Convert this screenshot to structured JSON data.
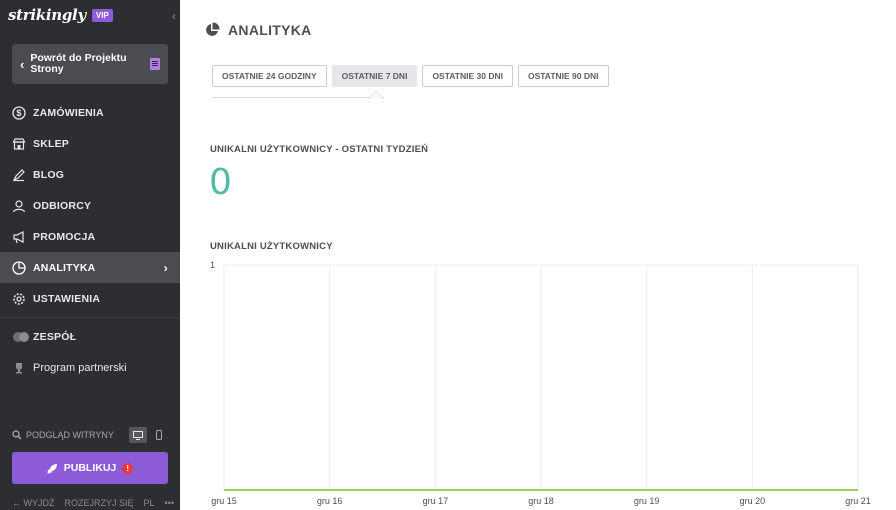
{
  "sidebar": {
    "brand": "strikingly",
    "badge": "VIP",
    "back_label": "Powrót do Projektu Strony",
    "items": [
      {
        "label": "ZAMÓWIENIA",
        "icon": "dollar-circle-icon"
      },
      {
        "label": "SKLEP",
        "icon": "store-icon"
      },
      {
        "label": "BLOG",
        "icon": "pen-icon"
      },
      {
        "label": "ODBIORCY",
        "icon": "audience-icon"
      },
      {
        "label": "PROMOCJA",
        "icon": "megaphone-icon"
      },
      {
        "label": "ANALITYKA",
        "icon": "pie-chart-icon",
        "active": true
      },
      {
        "label": "USTAWIENIA",
        "icon": "gear-icon"
      },
      {
        "label": "ZESPÓŁ",
        "icon": "team-icon"
      },
      {
        "label": "Program partnerski",
        "icon": "trophy-icon"
      }
    ],
    "preview_label": "PODGLĄD WITRYNY",
    "publish_label": "PUBLIKUJ",
    "footer": {
      "logout": "WYJDŹ",
      "browse": "ROZEJRZYJ SIĘ",
      "lang": "PL",
      "more": "•••"
    }
  },
  "main": {
    "title": "ANALITYKA",
    "tabs": [
      {
        "label": "OSTATNIE 24 GODZINY",
        "active": false
      },
      {
        "label": "OSTATNIE 7 DNI",
        "active": true
      },
      {
        "label": "OSTATNIE 30 DNI",
        "active": false
      },
      {
        "label": "OSTATNIE 90 DNI",
        "active": false
      }
    ],
    "stat_label": "UNIKALNI UŻYTKOWNICY - OSTATNI TYDZIEŃ",
    "stat_value": "0",
    "chart_label": "UNIKALNI UŻYTKOWNICY"
  },
  "colors": {
    "accent": "#8e5bd8",
    "stat": "#55b9a9",
    "line": "#9bd15a",
    "sidebar": "#2d2e32"
  },
  "chart_data": {
    "type": "line",
    "categories": [
      "gru 15",
      "gru 16",
      "gru 17",
      "gru 18",
      "gru 19",
      "gru 20",
      "gru 21"
    ],
    "series": [
      {
        "values": [
          0,
          0,
          0,
          0,
          0,
          0,
          0
        ]
      }
    ],
    "title": "UNIKALNI UŻYTKOWNICY",
    "ylim": [
      0,
      1
    ],
    "yticks": [
      "1"
    ],
    "grid": true
  }
}
